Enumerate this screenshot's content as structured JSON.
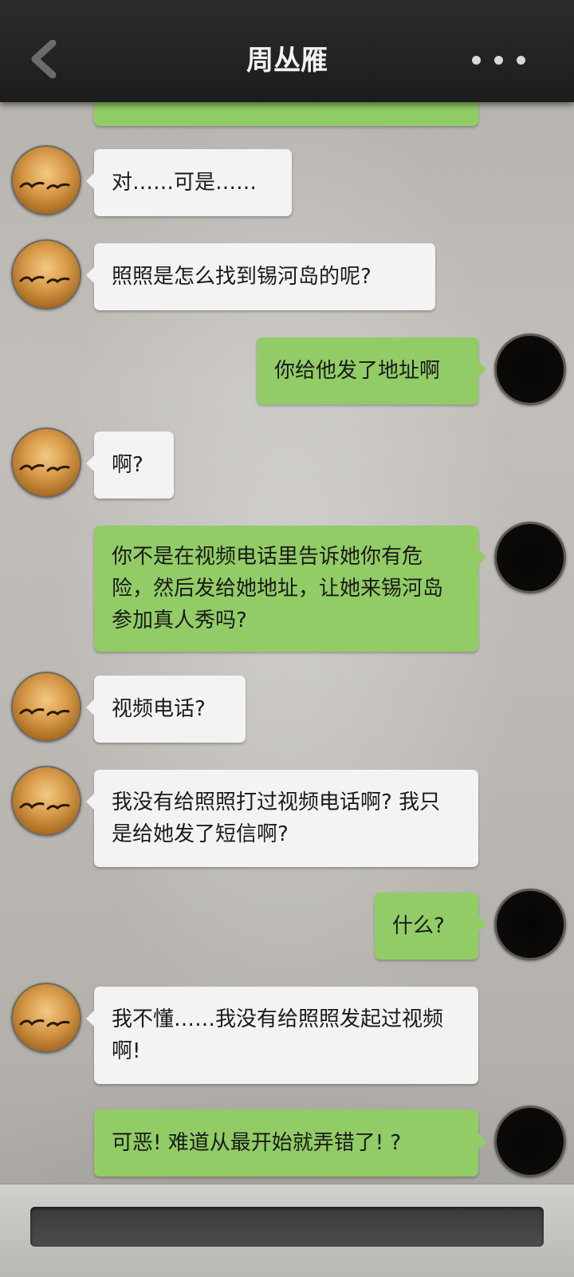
{
  "header": {
    "title": "周丛雁",
    "back_icon": "chevron-left-icon",
    "more_icon": "more-dots-icon"
  },
  "colors": {
    "header_bg": "#232221",
    "bubble_incoming": "#f3f3f3",
    "bubble_outgoing": "#92cc66",
    "background": "#bbb8b3"
  },
  "messages": [
    {
      "side": "left",
      "text": "对……可是……"
    },
    {
      "side": "left",
      "text": "照照是怎么找到锡河岛的呢?"
    },
    {
      "side": "right",
      "text": "你给他发了地址啊"
    },
    {
      "side": "left",
      "text": "啊?"
    },
    {
      "side": "right",
      "text": "你不是在视频电话里告诉她你有危险，然后发给她地址，让她来锡河岛参加真人秀吗?"
    },
    {
      "side": "left",
      "text": "视频电话?"
    },
    {
      "side": "left",
      "text": "我没有给照照打过视频电话啊? 我只是给她发了短信啊?"
    },
    {
      "side": "right",
      "text": "什么?"
    },
    {
      "side": "left",
      "text": "我不懂……我没有给照照发起过视频啊!"
    },
    {
      "side": "right",
      "text": "可恶! 难道从最开始就弄错了! ?"
    }
  ],
  "input": {
    "value": "",
    "placeholder": ""
  }
}
